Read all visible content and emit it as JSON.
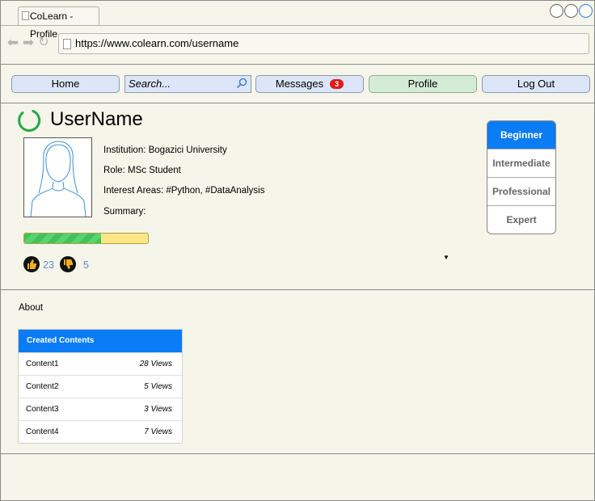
{
  "browser": {
    "tab_title": "CoLearn - Profile",
    "url": "https://www.colearn.com/username"
  },
  "menu": {
    "home": "Home",
    "search_placeholder": "Search...",
    "messages": "Messages",
    "messages_badge": "3",
    "profile": "Profile",
    "logout": "Log Out"
  },
  "profile": {
    "username": "UserName",
    "institution": "Institution: Bogazici University",
    "role": "Role: MSc Student",
    "interests": "Interest Areas: #Python, #DataAnalysis",
    "summary": "Summary:",
    "progress_fraction": 0.62,
    "upvotes": "23",
    "downvotes": "5"
  },
  "levels": {
    "items": [
      "Beginner",
      "Intermediate",
      "Professional",
      "Expert"
    ],
    "selected": "Beginner"
  },
  "about": {
    "label": "About",
    "table_title": "Created Contents",
    "rows": [
      {
        "name": "Content1",
        "views": "28 Views"
      },
      {
        "name": "Content2",
        "views": "5 Views"
      },
      {
        "name": "Content3",
        "views": "3 Views"
      },
      {
        "name": "Content4",
        "views": "7 Views"
      }
    ]
  },
  "colors": {
    "accent": "#0a7cf5",
    "menu_button": "#dce6f8",
    "profile_button": "#d4ebd5",
    "badge": "#e01b1b",
    "progress_fill": "#3fc25a",
    "progress_track": "#fbe786",
    "spinner": "#22aa44",
    "page_bg": "#f5f5e9"
  }
}
